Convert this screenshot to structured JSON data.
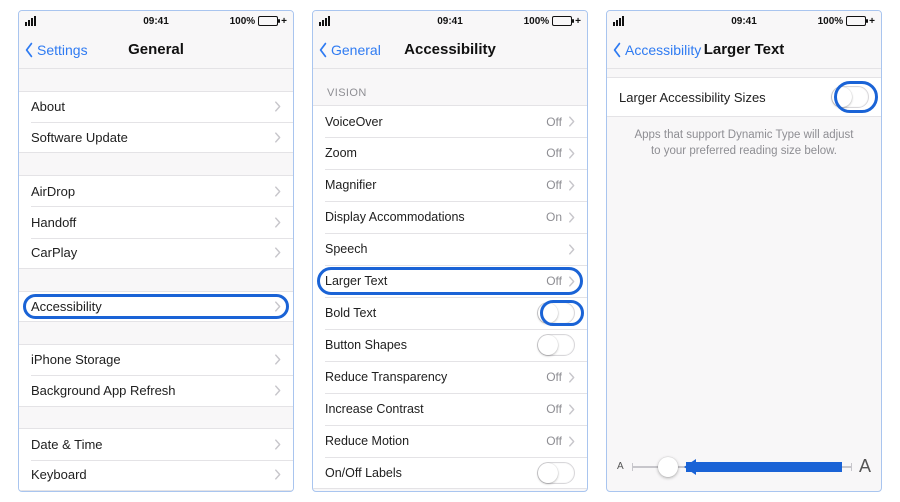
{
  "status": {
    "time": "09:41",
    "battery_pct": "100%"
  },
  "screen1": {
    "back": "Settings",
    "title": "General",
    "groups": [
      {
        "items": [
          {
            "label": "About"
          },
          {
            "label": "Software Update"
          }
        ]
      },
      {
        "items": [
          {
            "label": "AirDrop"
          },
          {
            "label": "Handoff"
          },
          {
            "label": "CarPlay"
          }
        ]
      },
      {
        "items": [
          {
            "label": "Accessibility",
            "highlight": true
          }
        ]
      },
      {
        "items": [
          {
            "label": "iPhone Storage"
          },
          {
            "label": "Background App Refresh"
          }
        ]
      },
      {
        "items": [
          {
            "label": "Date & Time"
          },
          {
            "label": "Keyboard"
          }
        ]
      }
    ]
  },
  "screen2": {
    "back": "General",
    "title": "Accessibility",
    "section_header": "VISION",
    "items": [
      {
        "label": "VoiceOver",
        "value": "Off",
        "type": "nav"
      },
      {
        "label": "Zoom",
        "value": "Off",
        "type": "nav"
      },
      {
        "label": "Magnifier",
        "value": "Off",
        "type": "nav"
      },
      {
        "label": "Display Accommodations",
        "value": "On",
        "type": "nav"
      },
      {
        "label": "Speech",
        "value": "",
        "type": "nav"
      },
      {
        "label": "Larger Text",
        "value": "Off",
        "type": "nav",
        "highlight": true
      },
      {
        "label": "Bold Text",
        "type": "toggle",
        "highlight_toggle": true
      },
      {
        "label": "Button Shapes",
        "type": "toggle"
      },
      {
        "label": "Reduce Transparency",
        "value": "Off",
        "type": "nav"
      },
      {
        "label": "Increase Contrast",
        "value": "Off",
        "type": "nav"
      },
      {
        "label": "Reduce Motion",
        "value": "Off",
        "type": "nav"
      },
      {
        "label": "On/Off Labels",
        "type": "toggle"
      }
    ]
  },
  "screen3": {
    "back": "Accessibility",
    "title": "Larger Text",
    "toggle_label": "Larger Accessibility Sizes",
    "footnote": "Apps that support Dynamic Type will adjust to your preferred reading size below.",
    "slider": {
      "min_label": "A",
      "max_label": "A",
      "ticks": 7,
      "thumb_index": 1
    }
  }
}
